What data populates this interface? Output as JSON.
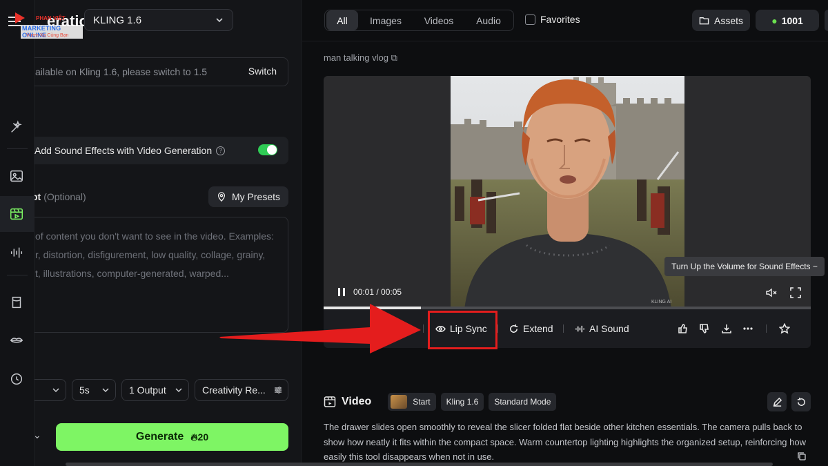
{
  "sidebar": {
    "header_title": "eration",
    "model": "KLING 1.6",
    "notice_text": "ailable on Kling 1.6, please switch to 1.5",
    "switch_label": "Switch",
    "sound_effects_label": "Add Sound Effects with Video Generation",
    "sound_effects_on": true,
    "negative_prompt_label": "pt",
    "negative_prompt_optional": "(Optional)",
    "presets_label": "My Presets",
    "negative_prompt_placeholder_lines": [
      "of content you don't want to see in the video. Examples:",
      "r, distortion, disfigurement, low quality, collage, grainy,",
      "t, illustrations, computer-generated, warped..."
    ],
    "duration": "5s",
    "outputs": "1 Output",
    "creativity": "Creativity Re...",
    "generate_label": "Generate",
    "generate_cost": "20"
  },
  "watermark": {
    "brand": "MARKETING ONLINE",
    "brand_top": "PHAN VIỆT",
    "tagline": "Vươn Xa Cùng Bạn"
  },
  "topbar": {
    "filters": [
      "All",
      "Images",
      "Videos",
      "Audio"
    ],
    "active_filter": "All",
    "favorites_label": "Favorites",
    "assets_label": "Assets",
    "credits": "1001"
  },
  "content": {
    "prompt_peek": "man talking vlog",
    "player": {
      "time": "00:01 / 00:05",
      "progress_percent": 20,
      "tooltip": "Turn Up the Volume for Sound Effects ~",
      "watermark": "KLING AI"
    },
    "actions": {
      "lip_sync": "Lip Sync",
      "extend": "Extend",
      "ai_sound": "AI Sound"
    },
    "video_section": {
      "title": "Video",
      "chips": [
        "Start",
        "Kling 1.6",
        "Standard Mode"
      ],
      "description": "The drawer slides open smoothly to reveal the slicer folded flat beside other kitchen essentials. The camera pulls back to show how neatly it fits within the compact space. Warm countertop lighting highlights the organized setup, reinforcing how easily this tool disappears when not in use."
    }
  },
  "colors": {
    "generate_green": "#7ef564",
    "highlight_red": "#e41d1d",
    "toggle_green": "#2fcc55"
  }
}
